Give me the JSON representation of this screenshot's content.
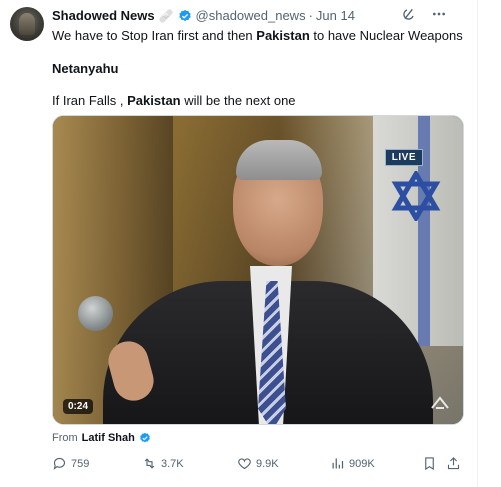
{
  "tweet": {
    "author_name": "Shadowed News",
    "emoji": "🩹",
    "handle": "@shadowed_news",
    "separator": "·",
    "date": "Jun 14",
    "line1_part1": "We have to Stop Iran first and then ",
    "line1_bold": "Pakistan",
    "line1_part2": " to have Nuclear Weapons",
    "line2": "Netanyahu",
    "line3_part1": "If Iran Falls , ",
    "line3_bold": "Pakistan",
    "line3_part2": " will be the next one"
  },
  "video": {
    "live_label": "LIVE",
    "duration": "0:24"
  },
  "from": {
    "label": "From",
    "name": "Latif Shah"
  },
  "metrics": {
    "replies": "759",
    "reposts": "3.7K",
    "likes": "9.9K",
    "views": "909K"
  },
  "colors": {
    "verified": "#1d9bf0",
    "text": "#0f1419",
    "secondary": "#536471"
  }
}
